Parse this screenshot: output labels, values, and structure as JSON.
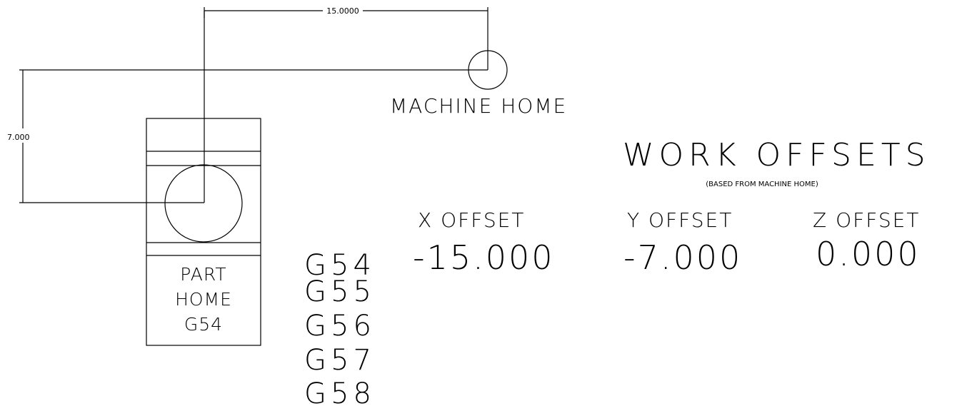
{
  "dimensions": {
    "horizontal": "15.0000",
    "vertical": "7.000"
  },
  "machine_home_label": "MACHINE HOME",
  "part": {
    "line1": "PART",
    "line2": "HOME",
    "line3": "G54"
  },
  "g_codes": [
    "G54",
    "G55",
    "G56",
    "G57",
    "G58"
  ],
  "work_offsets": {
    "title": "WORK OFFSETS",
    "subtitle": "(BASED FROM MACHINE HOME)",
    "columns": [
      {
        "header": "X OFFSET",
        "value": "-15.000"
      },
      {
        "header": "Y OFFSET",
        "value": "-7.000"
      },
      {
        "header": "Z OFFSET",
        "value": "0.000"
      }
    ]
  }
}
